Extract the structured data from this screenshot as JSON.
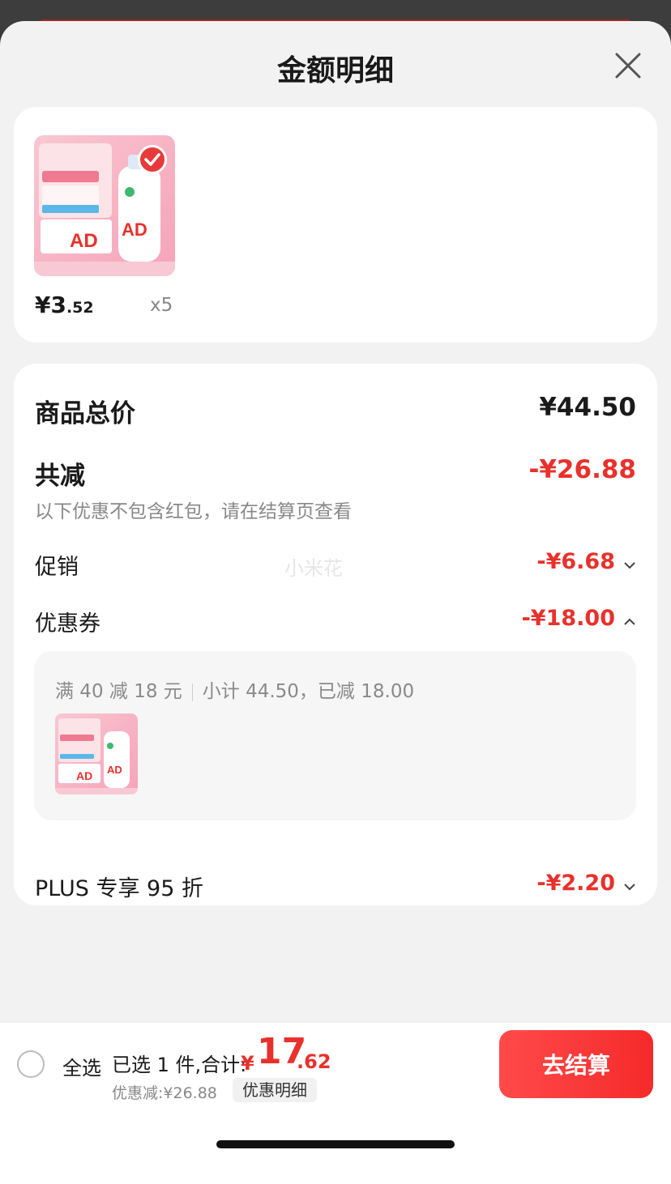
{
  "sheet": {
    "title": "金额明细"
  },
  "product": {
    "price_int": "¥3",
    "price_dec": ".52",
    "quantity": "x5"
  },
  "detail": {
    "total_label": "商品总价",
    "total_amount": "¥44.50",
    "reduce_label": "共减",
    "reduce_amount": "-¥26.88",
    "note": "以下优惠不包含红包，请在结算页查看",
    "watermark": "小米花",
    "promo_label": "促销",
    "promo_amount": "-¥6.68",
    "coupon_label": "优惠券",
    "coupon_amount": "-¥18.00",
    "coupon_rule": "满 40 减 18 元",
    "coupon_summary": "小计 44.50，已减 18.00",
    "plus_label": "PLUS 专享 95 折",
    "plus_amount": "-¥2.20"
  },
  "bottom_bar": {
    "select_all": "全选",
    "selected_text": "已选 1 件,合计:",
    "total_symbol": "¥",
    "total_int": "17",
    "total_dec": ".62",
    "discount_text": "优惠减:¥26.88",
    "detail_link": "优惠明细",
    "checkout_label": "去结算"
  },
  "colors": {
    "accent_red": "#e8312c",
    "checkout_gradient_start": "#ff4a4a",
    "checkout_gradient_end": "#f52a2a"
  }
}
